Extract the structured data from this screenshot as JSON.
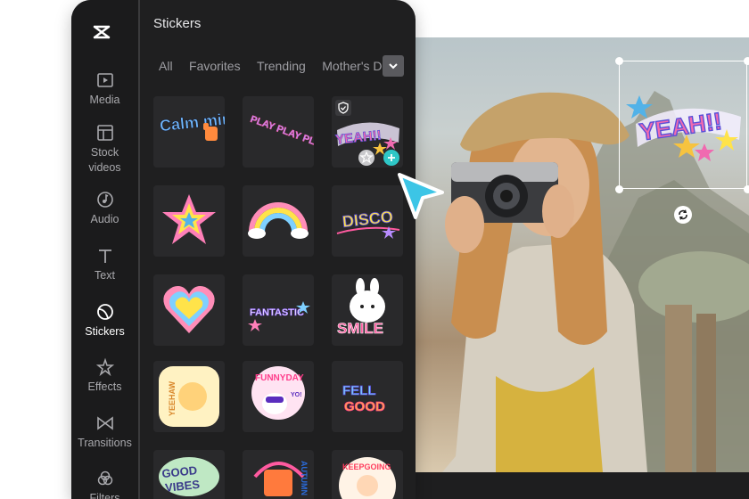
{
  "app": {
    "panel_title": "Stickers"
  },
  "sidebar": {
    "items": [
      {
        "label": "Media",
        "icon": "media-icon"
      },
      {
        "label": "Stock videos",
        "icon": "stock-videos-icon"
      },
      {
        "label": "Audio",
        "icon": "audio-icon"
      },
      {
        "label": "Text",
        "icon": "text-icon"
      },
      {
        "label": "Stickers",
        "icon": "stickers-icon",
        "active": true
      },
      {
        "label": "Effects",
        "icon": "effects-icon"
      },
      {
        "label": "Transitions",
        "icon": "transitions-icon"
      },
      {
        "label": "Filters",
        "icon": "filters-icon"
      }
    ]
  },
  "tabs": [
    "All",
    "Favorites",
    "Trending",
    "Mother's Day"
  ],
  "stickers": {
    "r1": [
      "Calm mind",
      "PLAY PLAY PLAY",
      "YEAH!!"
    ],
    "r3": [
      "FANTASTIC",
      "SMILE"
    ],
    "r4": [
      "YEEHAW",
      "FUNNYDAY",
      "YO!",
      "FELL GOOD"
    ],
    "r5": [
      "GOOD VIBES",
      "AUTUMN",
      "KEEPGOING"
    ]
  },
  "canvas": {
    "selected_sticker": "YEAH!!"
  },
  "colors": {
    "panel_bg": "#1f1f20",
    "rail_bg": "#1b1b1c",
    "accent_cursor": "#3cc5e6",
    "active_text": "#ffffff",
    "inactive_text": "#a9a9ad"
  }
}
